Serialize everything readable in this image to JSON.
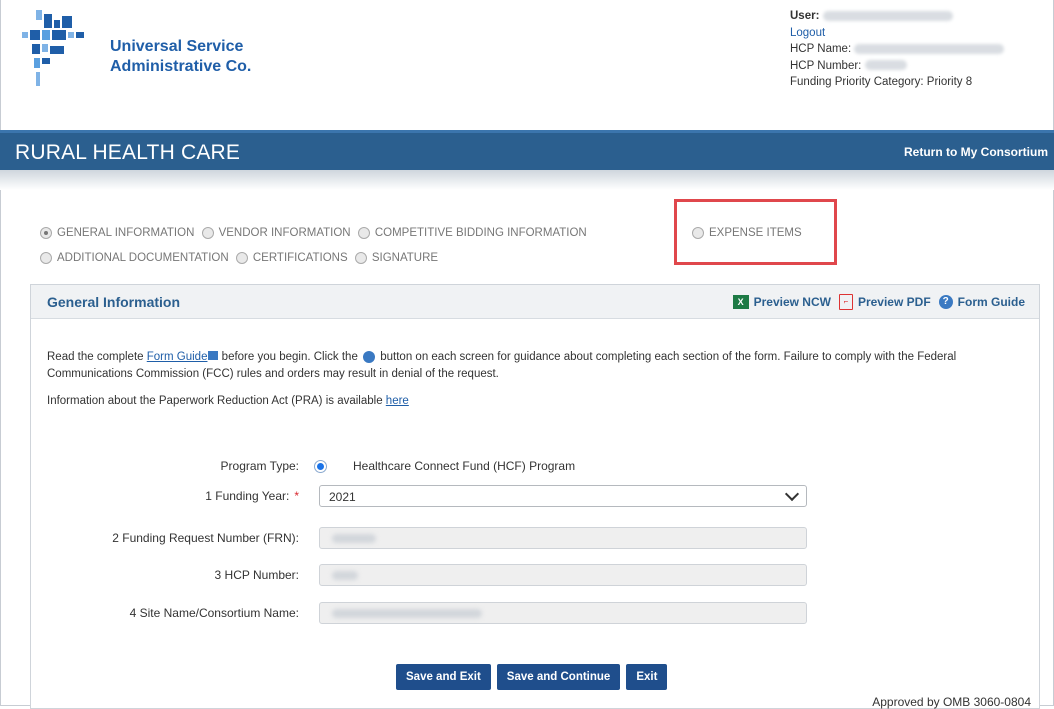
{
  "header": {
    "logo_line1": "Universal Service",
    "logo_line2": "Administrative Co.",
    "user_label": "User:",
    "logout": "Logout",
    "hcp_name_label": "HCP Name:",
    "hcp_number_label": "HCP Number:",
    "priority": "Funding Priority Category: Priority 8"
  },
  "banner": {
    "title": "RURAL HEALTH CARE",
    "link": "Return to My Consortium"
  },
  "steps": [
    {
      "label": "GENERAL INFORMATION",
      "active": true
    },
    {
      "label": "VENDOR INFORMATION",
      "active": false
    },
    {
      "label": "COMPETITIVE BIDDING INFORMATION",
      "active": false
    },
    {
      "label": "EXPENSE ITEMS",
      "active": false
    },
    {
      "label": "ADDITIONAL DOCUMENTATION",
      "active": false
    },
    {
      "label": "CERTIFICATIONS",
      "active": false
    },
    {
      "label": "SIGNATURE",
      "active": false
    }
  ],
  "panel": {
    "title": "General Information",
    "preview_ncw": "Preview NCW",
    "preview_pdf": "Preview PDF",
    "form_guide": "Form Guide",
    "intro_1": "Read the complete",
    "intro_link": "Form Guide",
    "intro_2": "before you begin. Click the",
    "intro_3": "button on each screen for guidance about completing each section of the form. Failure to comply with the Federal Communications Commission (FCC) rules and orders may result in denial of the request.",
    "pra_text": "Information about the Paperwork Reduction Act (PRA) is available",
    "pra_link": "here"
  },
  "form": {
    "program_type_label": "Program Type:",
    "program_type_value": "Healthcare Connect Fund (HCF) Program",
    "funding_year_label": "1 Funding Year:",
    "funding_year_value": "2021",
    "frn_label": "2 Funding Request Number (FRN):",
    "hcp_number_label": "3 HCP Number:",
    "site_name_label": "4 Site Name/Consortium Name:"
  },
  "buttons": {
    "save_exit": "Save and Exit",
    "save_continue": "Save and Continue",
    "exit": "Exit"
  },
  "footer": {
    "omb": "Approved by OMB 3060-0804"
  },
  "colors": {
    "banner": "#2b5f8f",
    "brand_blue": "#1f5ea8",
    "button": "#1f4e8c",
    "highlight": "#e0474c"
  }
}
